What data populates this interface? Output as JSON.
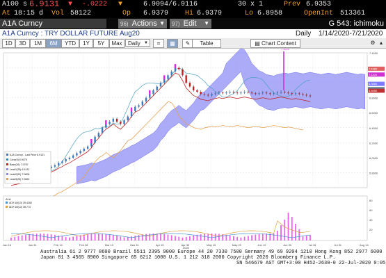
{
  "quote": {
    "ticker": "A100",
    "last_prefix": "s",
    "last": "6.9131",
    "change": "-.0222",
    "bid_ask": "6.9094/6.9116",
    "size": "30 x 1",
    "prev_label": "Prev",
    "prev": "6.9353",
    "time_label": "At",
    "time": "18:15 d",
    "vol_label": "Vol",
    "vol": "58122",
    "open_label": "Op",
    "open": "6.9379",
    "hi_label": "Hi",
    "hi": "6.9379",
    "lo_label": "Lo",
    "lo": "6.8958",
    "oi_label": "OpenInt",
    "oi": "513361"
  },
  "toolbar": {
    "security": "A1A Curncy",
    "actions_num": "96)",
    "actions": "Actions",
    "edit_num": "97)",
    "edit": "Edit",
    "function": "G 543: ichimoku"
  },
  "title": {
    "name": "A1A Curncy : TRY DOLLAR FUTURE Aug20",
    "period": "Daily",
    "range": "1/14/2020-7/21/2020"
  },
  "ranges": [
    "1D",
    "3D",
    "1M",
    "6M",
    "YTD",
    "1Y",
    "5Y",
    "Max"
  ],
  "selected_range": "6M",
  "interval": "Daily",
  "table_label": "Table",
  "chart_content": "Chart Content",
  "chart_data": {
    "type": "candlestick",
    "title": "A1A Curncy",
    "x_labels": [
      "Jan 16",
      "Jan 31",
      "Feb 14",
      "Feb 28",
      "Mar 13",
      "Mar 31",
      "Apr 15",
      "Apr 30",
      "May 15",
      "May 29",
      "Jun 12",
      "Jun 30",
      "Jul 16",
      "Jul 31",
      "Aug 14"
    ],
    "year_label": "2020",
    "ylim": [
      5.6,
      7.4
    ],
    "y_ticks": [
      "7.4000",
      "7.2000",
      "7.0000",
      "6.8000",
      "6.6000",
      "6.4000",
      "6.2000",
      "6.0000",
      "5.8000"
    ],
    "right_labels": [
      {
        "text": "7.1880",
        "color": "#e06060",
        "y": 7.188
      },
      {
        "text": "7.1100",
        "color": "#d030d0",
        "y": 7.11
      },
      {
        "text": "6.9860",
        "color": "#7a7aff",
        "y": 6.986
      },
      {
        "text": "6.9131",
        "color": "#333333",
        "y": 6.913
      },
      {
        "text": "6.9075",
        "color": "#4aa0c0",
        "y": 6.907
      },
      {
        "text": "6.8950",
        "color": "#c03030",
        "y": 6.895
      }
    ],
    "peak_label": "7.4210",
    "legend": [
      {
        "text": "A1A Curncy - Last Price 6.9131",
        "color": "#4a70c0"
      },
      {
        "text": "Conv(9)  6.9075",
        "color": "#2a8ab0"
      },
      {
        "text": "Base(26)  7.0767",
        "color": "#c02020"
      },
      {
        "text": "Lead1(26)  6.9131",
        "color": "#8888ee"
      },
      {
        "text": "Lead2(52)  7.0608",
        "color": "#8888ee"
      },
      {
        "text": "Lead3(26)  7.0662",
        "color": "#e0a060"
      }
    ],
    "candles": [
      5.7,
      5.71,
      5.72,
      5.73,
      5.75,
      5.74,
      5.76,
      5.78,
      5.8,
      5.83,
      5.86,
      5.88,
      5.9,
      5.93,
      5.95,
      5.98,
      6.0,
      6.03,
      6.06,
      6.09,
      6.12,
      6.15,
      6.2,
      6.28,
      6.33,
      6.4,
      6.45,
      6.48,
      6.52,
      6.48,
      6.45,
      6.5,
      6.55,
      6.62,
      6.68,
      6.7,
      6.75,
      6.8,
      6.85,
      6.9,
      6.95,
      7.0,
      7.05,
      7.1,
      7.15,
      7.2,
      7.18,
      7.1,
      7.0,
      6.95,
      6.9,
      6.88,
      6.85,
      6.84,
      6.83,
      6.85,
      6.86,
      6.87,
      6.86,
      6.87,
      6.88,
      6.87,
      6.86,
      6.87,
      6.88,
      6.87,
      6.86,
      6.85,
      6.86,
      6.87,
      6.86,
      6.85,
      6.86,
      6.87,
      6.88,
      6.87,
      6.86,
      6.85,
      6.86,
      6.85,
      6.84,
      6.83,
      6.82
    ],
    "sub_panel": {
      "title": "A1A",
      "legend": [
        {
          "text": "ADX Wi(13) 39.4282",
          "color": "#4090d0"
        },
        {
          "text": "ADX Wi(13) 38.773",
          "color": "#e0a040"
        }
      ],
      "y_ticks": [
        "80",
        "60",
        "40",
        "20"
      ]
    }
  },
  "footer": {
    "line1": "Australia 61 2 9777 8600  Brazil 5511 2395 9000  Europe 44 20 7330 7500  Germany 49 69 9204 1210  Hong Kong 852 2977 6000",
    "line2": "Japan 81 3 4565 8900        Singapore 65 6212 1000        U.S. 1 212 318 2000        Copyright 2020 Bloomberg Finance L.P.",
    "line3": "SN 546679 AST  GMT+3:00 H452-2630-0 22-Jul-2020 0:05:49"
  }
}
